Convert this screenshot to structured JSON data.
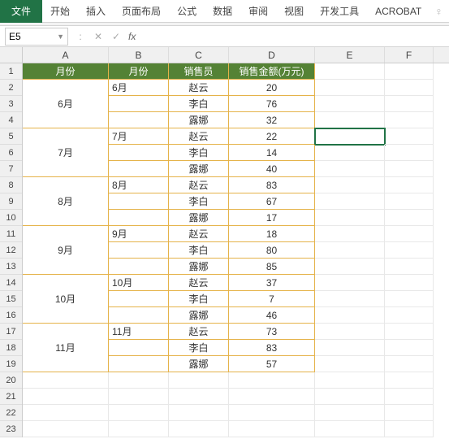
{
  "ribbon": {
    "file": "文件",
    "tabs": [
      "开始",
      "插入",
      "页面布局",
      "公式",
      "数据",
      "审阅",
      "视图",
      "开发工具",
      "ACROBAT"
    ]
  },
  "formula_bar": {
    "name_box": "E5",
    "fx_label": "fx",
    "value": ""
  },
  "columns": [
    "A",
    "B",
    "C",
    "D",
    "E",
    "F"
  ],
  "row_count": 23,
  "active_cell": "E5",
  "headers": {
    "A": "月份",
    "B": "月份",
    "C": "销售员",
    "D": "销售金额(万元)"
  },
  "chart_data": {
    "type": "table",
    "title": "销售金额(万元)",
    "columns": [
      "月份",
      "月份",
      "销售员",
      "销售金额(万元)"
    ],
    "groups": [
      {
        "month_merged": "6月",
        "month": "6月",
        "rows": [
          {
            "sales": "赵云",
            "amount": 20
          },
          {
            "sales": "李白",
            "amount": 76
          },
          {
            "sales": "露娜",
            "amount": 32
          }
        ]
      },
      {
        "month_merged": "7月",
        "month": "7月",
        "rows": [
          {
            "sales": "赵云",
            "amount": 22
          },
          {
            "sales": "李白",
            "amount": 14
          },
          {
            "sales": "露娜",
            "amount": 40
          }
        ]
      },
      {
        "month_merged": "8月",
        "month": "8月",
        "rows": [
          {
            "sales": "赵云",
            "amount": 83
          },
          {
            "sales": "李白",
            "amount": 67
          },
          {
            "sales": "露娜",
            "amount": 17
          }
        ]
      },
      {
        "month_merged": "9月",
        "month": "9月",
        "rows": [
          {
            "sales": "赵云",
            "amount": 18
          },
          {
            "sales": "李白",
            "amount": 80
          },
          {
            "sales": "露娜",
            "amount": 85
          }
        ]
      },
      {
        "month_merged": "10月",
        "month": "10月",
        "rows": [
          {
            "sales": "赵云",
            "amount": 37
          },
          {
            "sales": "李白",
            "amount": 7
          },
          {
            "sales": "露娜",
            "amount": 46
          }
        ]
      },
      {
        "month_merged": "11月",
        "month": "11月",
        "rows": [
          {
            "sales": "赵云",
            "amount": 73
          },
          {
            "sales": "李白",
            "amount": 83
          },
          {
            "sales": "露娜",
            "amount": 57
          }
        ]
      }
    ]
  }
}
